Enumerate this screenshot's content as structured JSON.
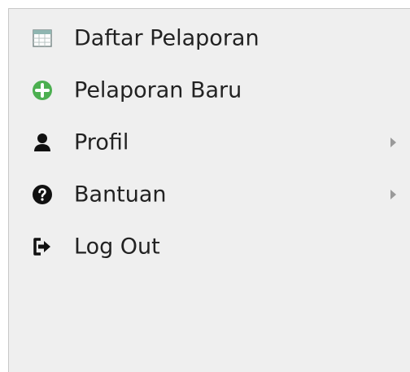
{
  "menu": {
    "items": [
      {
        "label": "Daftar Pelaporan",
        "icon": "table-icon",
        "has_submenu": false
      },
      {
        "label": "Pelaporan Baru",
        "icon": "add-circle-icon",
        "has_submenu": false
      },
      {
        "label": "Profil",
        "icon": "user-icon",
        "has_submenu": true
      },
      {
        "label": "Bantuan",
        "icon": "help-circle-icon",
        "has_submenu": true
      },
      {
        "label": "Log Out",
        "icon": "logout-icon",
        "has_submenu": false
      }
    ]
  },
  "colors": {
    "panel_background": "#efefef",
    "panel_border": "#c8c8c8",
    "text": "#222222",
    "add_icon_green": "#4caf50",
    "submenu_arrow": "#9a9a9a"
  }
}
